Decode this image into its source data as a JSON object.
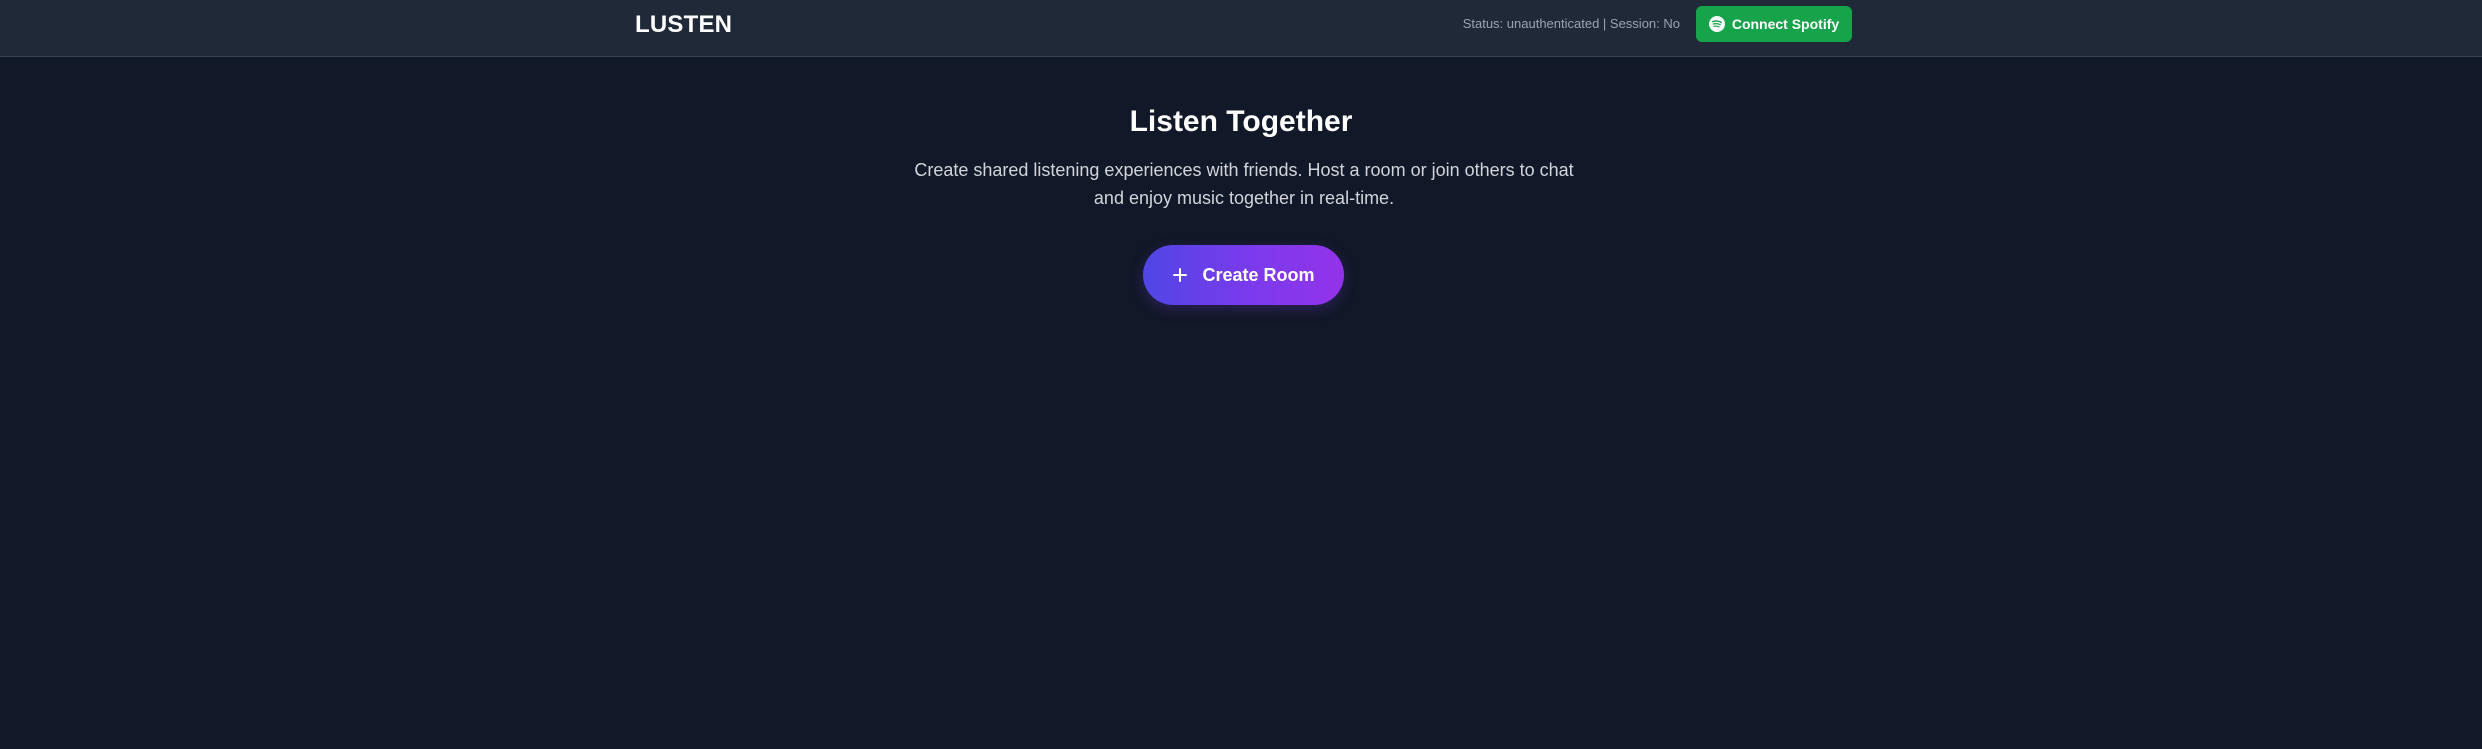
{
  "app": {
    "logo": "LUSTEN"
  },
  "header": {
    "status_text": "Status: unauthenticated | Session: No",
    "connect_button_label": "Connect Spotify",
    "connect_icon": "spotify-icon"
  },
  "hero": {
    "title": "Listen Together",
    "subtitle": "Create shared listening experiences with friends. Host a room or join others to chat and enjoy music together in real-time.",
    "create_button_label": "Create Room",
    "create_icon": "plus-icon"
  },
  "colors": {
    "background": "#111827",
    "navbar": "#1f2937",
    "spotify_green": "#16a34a",
    "gradient_start": "#4f46e5",
    "gradient_end": "#9333ea"
  }
}
